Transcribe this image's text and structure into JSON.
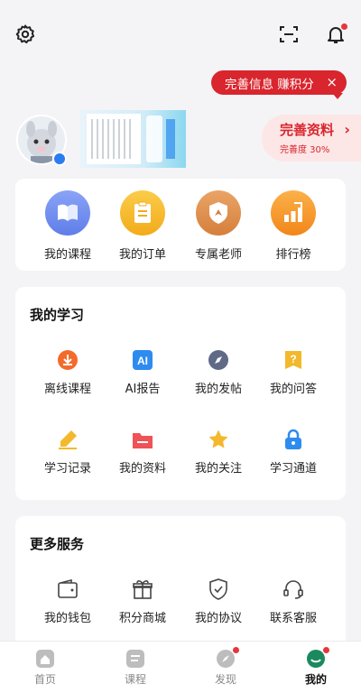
{
  "header": {
    "icons": [
      "settings-icon",
      "scan-icon",
      "bell-icon"
    ],
    "notification_dot": true
  },
  "promo": {
    "label": "完善信息 赚积分",
    "close": "×"
  },
  "profile": {
    "cta_title": "完善资料",
    "cta_progress": "完善度  30%",
    "progress_value": 0.3
  },
  "quick_actions": [
    {
      "label": "我的课程",
      "icon": "book-icon",
      "color": "#6d8cf3"
    },
    {
      "label": "我的订单",
      "icon": "order-icon",
      "color": "#f6b92c"
    },
    {
      "label": "专属老师",
      "icon": "teacher-badge-icon",
      "color": "#e0904d"
    },
    {
      "label": "排行榜",
      "icon": "ranking-icon",
      "color": "#f39a2e"
    }
  ],
  "study": {
    "title": "我的学习",
    "items": [
      {
        "label": "离线课程",
        "icon": "download-icon",
        "color": "#f26b2c"
      },
      {
        "label": "AI报告",
        "icon": "ai-report-icon",
        "color": "#2e8bf0"
      },
      {
        "label": "我的发帖",
        "icon": "compass-icon",
        "color": "#5f6b86"
      },
      {
        "label": "我的问答",
        "icon": "question-icon",
        "color": "#f3b82c"
      },
      {
        "label": "学习记录",
        "icon": "pencil-icon",
        "color": "#f3b82c"
      },
      {
        "label": "我的资料",
        "icon": "folder-icon",
        "color": "#ef5358"
      },
      {
        "label": "我的关注",
        "icon": "star-icon",
        "color": "#f3b82c"
      },
      {
        "label": "学习通道",
        "icon": "lock-icon",
        "color": "#2e8bf0"
      }
    ]
  },
  "services": {
    "title": "更多服务",
    "items": [
      {
        "label": "我的钱包",
        "icon": "wallet-icon"
      },
      {
        "label": "积分商城",
        "icon": "gift-icon"
      },
      {
        "label": "我的协议",
        "icon": "shield-check-icon"
      },
      {
        "label": "联系客服",
        "icon": "headset-icon"
      }
    ]
  },
  "tabs": [
    {
      "label": "首页",
      "icon": "home-icon",
      "active": false,
      "dot": false
    },
    {
      "label": "课程",
      "icon": "course-icon",
      "active": false,
      "dot": false
    },
    {
      "label": "发现",
      "icon": "discover-icon",
      "active": false,
      "dot": true
    },
    {
      "label": "我的",
      "icon": "me-icon",
      "active": true,
      "dot": true
    }
  ],
  "colors": {
    "accent": "#d9252d",
    "active_tab": "#1a8a5e"
  }
}
